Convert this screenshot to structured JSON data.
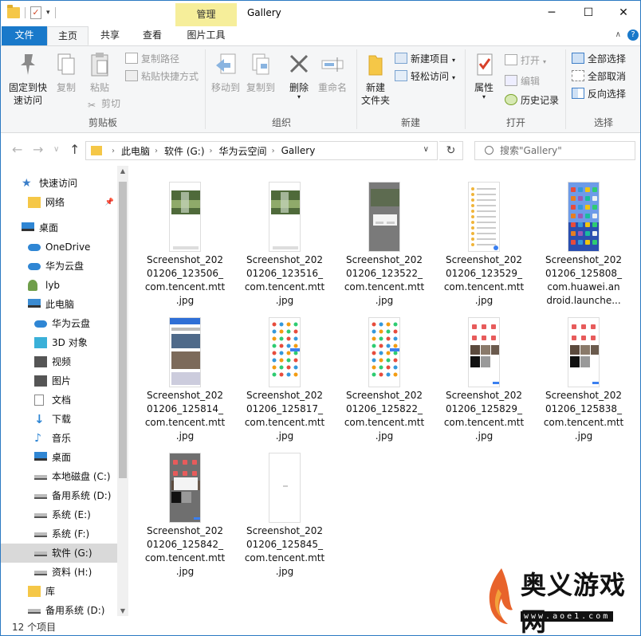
{
  "window": {
    "title": "Gallery",
    "context_tab": "管理",
    "minimize": "─",
    "maximize": "☐",
    "close": "✕"
  },
  "ribbon_tabs": [
    {
      "label": "文件"
    },
    {
      "label": "主页"
    },
    {
      "label": "共享"
    },
    {
      "label": "查看"
    },
    {
      "label": "图片工具"
    }
  ],
  "ribbon": {
    "clipboard": {
      "title": "剪贴板",
      "pin": "固定到快\n速访问",
      "pin_l1": "固定到快",
      "pin_l2": "速访问",
      "copy": "复制",
      "paste": "粘贴",
      "copy_path": "复制路径",
      "paste_shortcut": "粘贴快捷方式",
      "cut": "剪切"
    },
    "organize": {
      "title": "组织",
      "move_to": "移动到",
      "copy_to": "复制到",
      "delete": "删除",
      "rename": "重命名"
    },
    "new": {
      "title": "新建",
      "new_folder_l1": "新建",
      "new_folder_l2": "文件夹",
      "new_item": "新建项目",
      "easy_access": "轻松访问"
    },
    "open": {
      "title": "打开",
      "properties": "属性",
      "open": "打开",
      "edit": "编辑",
      "history": "历史记录"
    },
    "select": {
      "title": "选择",
      "select_all": "全部选择",
      "select_none": "全部取消",
      "invert": "反向选择"
    }
  },
  "address": {
    "crumbs": [
      "此电脑",
      "软件 (G:)",
      "华为云空间",
      "Gallery"
    ],
    "search_placeholder": "搜索\"Gallery\""
  },
  "nav": [
    {
      "label": "快速访问",
      "icon": "star-icon",
      "indent": 0
    },
    {
      "label": "网络",
      "icon": "folder-icon",
      "indent": 1,
      "pinned": true
    },
    {
      "label": "桌面",
      "icon": "desktop-icon",
      "indent": 0
    },
    {
      "label": "OneDrive",
      "icon": "cloud-icon",
      "indent": 1
    },
    {
      "label": "华为云盘",
      "icon": "cloud-icon",
      "indent": 1
    },
    {
      "label": "lyb",
      "icon": "user-icon",
      "indent": 1
    },
    {
      "label": "此电脑",
      "icon": "computer-icon",
      "indent": 1
    },
    {
      "label": "华为云盘",
      "icon": "cloud-icon",
      "indent": 2
    },
    {
      "label": "3D 对象",
      "icon": "cube-icon",
      "indent": 2
    },
    {
      "label": "视频",
      "icon": "video-icon",
      "indent": 2
    },
    {
      "label": "图片",
      "icon": "picture-icon",
      "indent": 2
    },
    {
      "label": "文档",
      "icon": "document-icon",
      "indent": 2
    },
    {
      "label": "下载",
      "icon": "download-icon",
      "indent": 2
    },
    {
      "label": "音乐",
      "icon": "music-icon",
      "indent": 2
    },
    {
      "label": "桌面",
      "icon": "desktop-icon",
      "indent": 2
    },
    {
      "label": "本地磁盘 (C:)",
      "icon": "drive-icon",
      "indent": 2
    },
    {
      "label": "备用系统 (D:)",
      "icon": "drive-icon",
      "indent": 2
    },
    {
      "label": "系统 (E:)",
      "icon": "drive-icon",
      "indent": 2
    },
    {
      "label": "系统 (F:)",
      "icon": "drive-icon",
      "indent": 2
    },
    {
      "label": "软件 (G:)",
      "icon": "drive-icon",
      "indent": 2,
      "selected": true
    },
    {
      "label": "资料 (H:)",
      "icon": "drive-icon",
      "indent": 2
    },
    {
      "label": "库",
      "icon": "library-icon",
      "indent": 1
    },
    {
      "label": "备用系统 (D:)",
      "icon": "drive-icon",
      "indent": 1
    }
  ],
  "files": [
    {
      "l1": "Screenshot_202",
      "l2": "01206_123506_",
      "l3": "com.tencent.mtt",
      "l4": ".jpg",
      "kind": "nature"
    },
    {
      "l1": "Screenshot_202",
      "l2": "01206_123516_",
      "l3": "com.tencent.mtt",
      "l4": ".jpg",
      "kind": "nature"
    },
    {
      "l1": "Screenshot_202",
      "l2": "01206_123522_",
      "l3": "com.tencent.mtt",
      "l4": ".jpg",
      "kind": "dialog"
    },
    {
      "l1": "Screenshot_202",
      "l2": "01206_123529_",
      "l3": "com.tencent.mtt",
      "l4": ".jpg",
      "kind": "list"
    },
    {
      "l1": "Screenshot_202",
      "l2": "01206_125808_",
      "l3": "com.huawei.an",
      "l4": "droid.launche...",
      "kind": "home"
    },
    {
      "l1": "Screenshot_202",
      "l2": "01206_125814_",
      "l3": "com.tencent.mtt",
      "l4": ".jpg",
      "kind": "news"
    },
    {
      "l1": "Screenshot_202",
      "l2": "01206_125817_",
      "l3": "com.tencent.mtt",
      "l4": ".jpg",
      "kind": "grid"
    },
    {
      "l1": "Screenshot_202",
      "l2": "01206_125822_",
      "l3": "com.tencent.mtt",
      "l4": ".jpg",
      "kind": "grid"
    },
    {
      "l1": "Screenshot_202",
      "l2": "01206_125829_",
      "l3": "com.tencent.mtt",
      "l4": ".jpg",
      "kind": "photos"
    },
    {
      "l1": "Screenshot_202",
      "l2": "01206_125838_",
      "l3": "com.tencent.mtt",
      "l4": ".jpg",
      "kind": "photos"
    },
    {
      "l1": "Screenshot_202",
      "l2": "01206_125842_",
      "l3": "com.tencent.mtt",
      "l4": ".jpg",
      "kind": "photos-dialog"
    },
    {
      "l1": "Screenshot_202",
      "l2": "01206_125845_",
      "l3": "com.tencent.mtt",
      "l4": ".jpg",
      "kind": "blank"
    }
  ],
  "status": {
    "count": "12 个项目"
  },
  "watermark": {
    "text": "奥义游戏网",
    "url": "www.aoe1.com"
  },
  "colors": {
    "accent": "#1979ca",
    "context_tab": "#f6ee9a",
    "folder": "#f5c747"
  }
}
